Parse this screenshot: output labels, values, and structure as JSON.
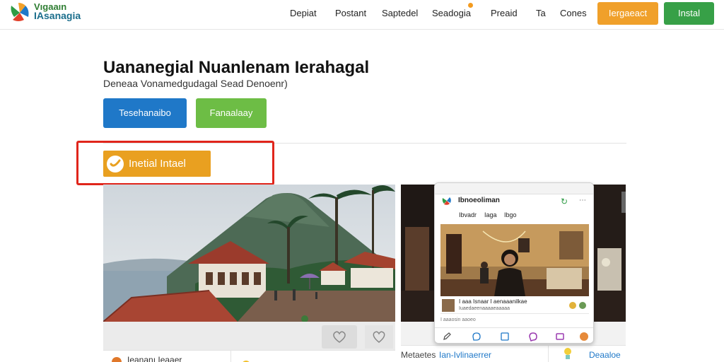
{
  "brand": {
    "line1": "Vıgaaın",
    "line2": "IAsanagia"
  },
  "nav": [
    {
      "label": "Depiat"
    },
    {
      "label": "Postant"
    },
    {
      "label": "Saptedel"
    },
    {
      "label": "Seadogia"
    },
    {
      "label": "Preaid"
    },
    {
      "label": "Ta"
    },
    {
      "label": "Cones"
    }
  ],
  "header_buttons": {
    "orange": "Iergaeact",
    "green": "Instal"
  },
  "hero": {
    "title": "Uananegial Nuanlenam Ierahagal",
    "subtitle": "Deneaa Vonamedgudagal Sead Denoenr)",
    "primary_button": "Tesehanaibo",
    "secondary_button": "Fanaalaay",
    "install_button": "Inetial  Intael"
  },
  "phone": {
    "app_name": "Ibnoeoliman",
    "tabs": [
      "Ibvadr",
      "Iaga",
      "Ibgo"
    ],
    "row_title": "I aaa Isnaar I aenaaanilkae",
    "row_sub": "Iuaedaeenaaaaeaaaaa",
    "meta": "I aaaosin aaoeo"
  },
  "cards": {
    "left_footer": "Ieananı Ieaaer",
    "right_label": "Metaetes",
    "right_link": "Ian-Ivlinaerrer",
    "right_link2": "Deaaloe"
  },
  "colors": {
    "accent_orange": "#f0a02a",
    "accent_green": "#37a047",
    "primary_blue": "#1f78c8",
    "secondary_green": "#6dbd45",
    "highlight_red": "#e0251b"
  }
}
